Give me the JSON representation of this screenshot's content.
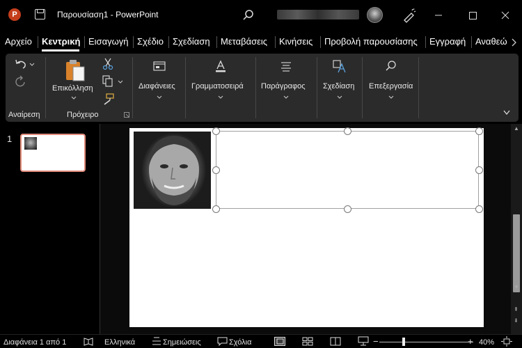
{
  "titlebar": {
    "app_icon_letter": "P",
    "title": "Παρουσίαση1 - PowerPoint",
    "icons": [
      "powerpoint-logo-icon",
      "save-icon",
      "search-icon",
      "pen-icon"
    ]
  },
  "menu": {
    "tabs": [
      "Αρχείο",
      "Κεντρική",
      "Εισαγωγή",
      "Σχέδιο",
      "Σχεδίαση",
      "Μεταβάσεις",
      "Κινήσεις",
      "Προβολή παρουσίασης",
      "Εγγραφή",
      "Αναθεώ"
    ],
    "active_tab": "Κεντρική"
  },
  "ribbon": {
    "undo_group": "Αναίρεση",
    "clipboard_group": "Πρόχειρο",
    "paste_label": "Επικόλληση",
    "slides_label": "Διαφάνειες",
    "font_label": "Γραμματοσειρά",
    "paragraph_label": "Παράγραφος",
    "design_label": "Σχεδίαση",
    "editing_label": "Επεξεργασία"
  },
  "slides_pane": {
    "slide_number": "1"
  },
  "statusbar": {
    "slide_info": "Διαφάνεια 1 από 1",
    "language": "Ελληνικά",
    "notes": "Σημειώσεις",
    "comments": "Σχόλια",
    "zoom": "40%"
  },
  "colors": {
    "background": "#000000",
    "ribbon": "#2b2b2b",
    "accent": "#c43e1c",
    "thumb_border": "#e08a7a"
  }
}
